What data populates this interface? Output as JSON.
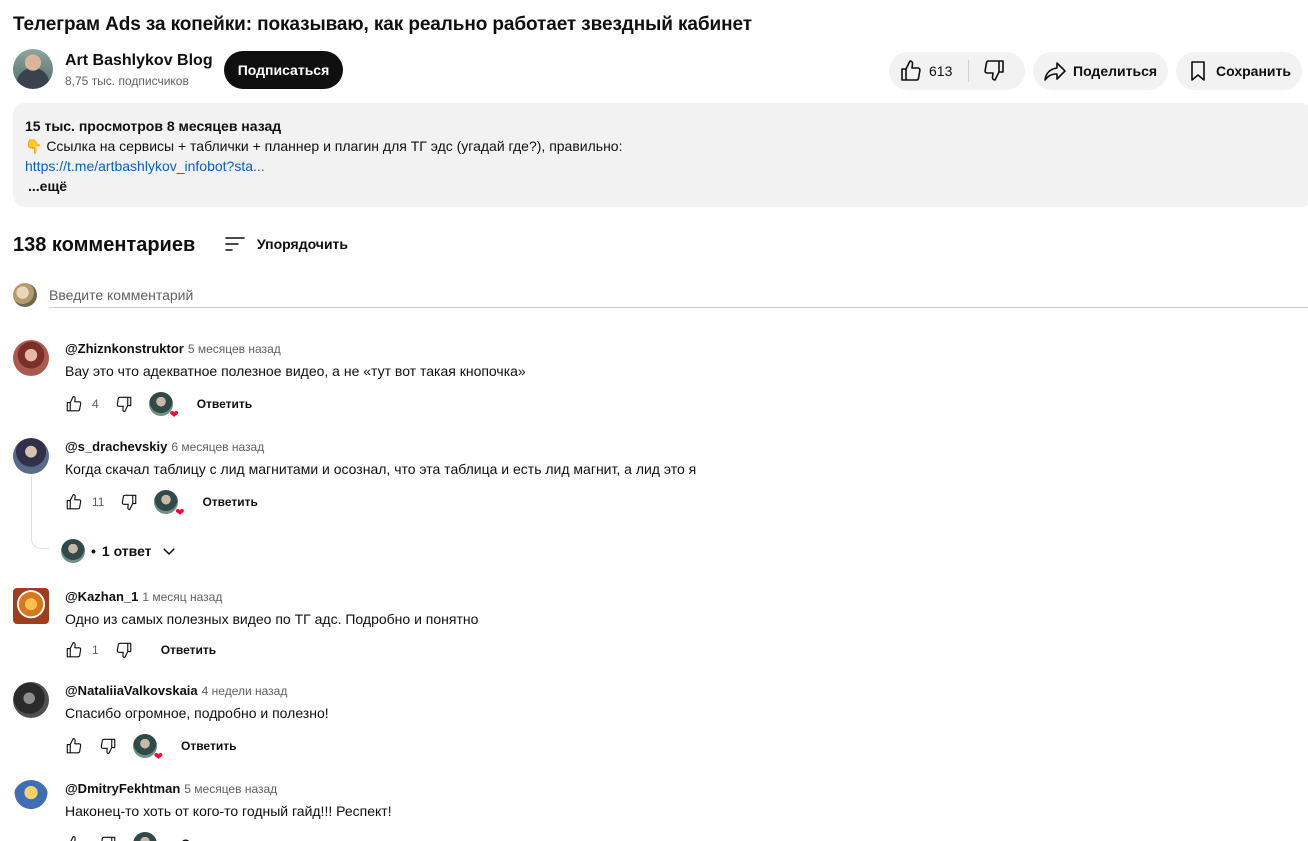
{
  "video": {
    "title": "Телеграм Ads за копейки: показываю, как реально работает звездный кабинет"
  },
  "channel": {
    "name": "Art Bashlykov Blog",
    "subscribers": "8,75 тыс. подписчиков",
    "subscribe_label": "Подписаться"
  },
  "actions": {
    "likes": "613",
    "share_label": "Поделиться",
    "save_label": "Сохранить"
  },
  "description": {
    "meta": "15 тыс. просмотров  8 месяцев назад",
    "text": "👇 Ссылка на сервисы + таблички + планнер и плагин для ТГ эдс (угадай где?), правильно:",
    "link": "https://t.me/artbashlykov_infobot?sta...",
    "more_label": "...ещё"
  },
  "comments_section": {
    "count_label": "138 комментариев",
    "sort_label": "Упорядочить",
    "input_placeholder": "Введите комментарий",
    "reply_label": "Ответить",
    "replies_toggle": "1 ответ"
  },
  "comments": [
    {
      "author": "@Zhiznkonstruktor",
      "time": "5 месяцев назад",
      "text": "Вау это что адекватное полезное видео, а не «тут вот такая кнопочка»",
      "likes": "4",
      "hearted": true
    },
    {
      "author": "@s_drachevskiy",
      "time": "6 месяцев назад",
      "text": "Когда скачал таблицу с лид магнитами и осознал, что эта таблица и есть лид магнит, а лид это я",
      "likes": "11",
      "hearted": true
    },
    {
      "author": "@Kazhan_1",
      "time": "1 месяц назад",
      "text": "Одно из самых полезных видео по ТГ адс. Подробно и понятно",
      "likes": "1",
      "hearted": false
    },
    {
      "author": "@NataliiaValkovskaia",
      "time": "4 недели назад",
      "text": "Спасибо огромное, подробно и полезно!",
      "likes": "",
      "hearted": true
    },
    {
      "author": "@DmitryFekhtman",
      "time": "5 месяцев назад",
      "text": "Наконец-то хоть от кого-то годный гайд!!! Респект!",
      "likes": "",
      "hearted": true
    }
  ],
  "colors": {
    "link": "#065fd4",
    "heart": "#ff0033",
    "pill_bg": "#f2f2f2"
  }
}
